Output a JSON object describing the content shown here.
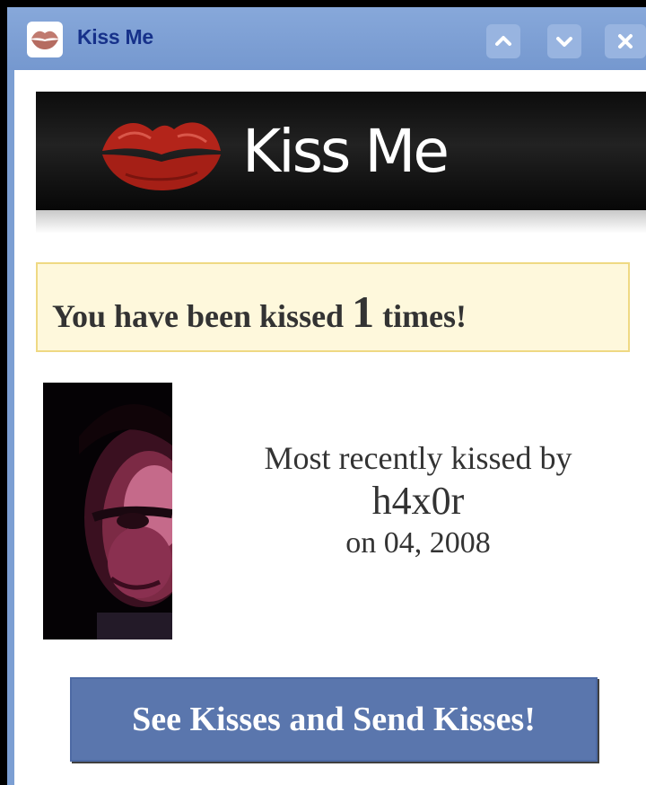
{
  "window": {
    "title": "Kiss Me",
    "app_icon": "lips-icon",
    "controls": [
      "chevron-up-icon",
      "chevron-down-icon",
      "close-icon"
    ]
  },
  "banner": {
    "logo_icon": "lips-icon",
    "title": "Kiss Me",
    "logo_color": "#b3241a"
  },
  "notice": {
    "prefix": "You have been kissed",
    "count": "1",
    "suffix": "times!"
  },
  "recent": {
    "label": "Most recently kissed by",
    "name": "h4x0r",
    "date": "on 04, 2008",
    "photo": "avatar"
  },
  "action": {
    "label": "See Kisses and Send Kisses!"
  },
  "colors": {
    "titlebar": "#7c9fd3",
    "notice_bg": "#fef8dc",
    "button": "#5a76ad"
  }
}
